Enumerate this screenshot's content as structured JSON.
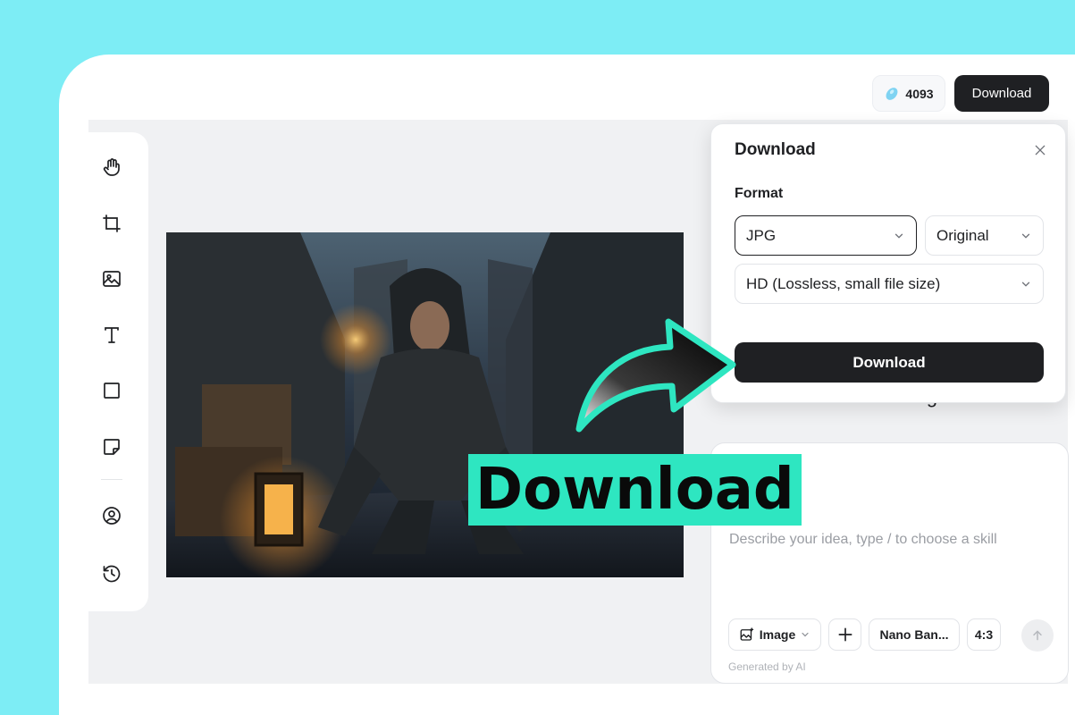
{
  "header": {
    "credits": "4093",
    "download_label": "Download"
  },
  "toolbar": {
    "tools": [
      {
        "icon": "hand-icon"
      },
      {
        "icon": "crop-icon"
      },
      {
        "icon": "image-icon"
      },
      {
        "icon": "text-icon"
      },
      {
        "icon": "rectangle-icon"
      },
      {
        "icon": "sticky-note-icon"
      },
      {
        "icon": "user-circle-icon"
      },
      {
        "icon": "history-icon"
      }
    ]
  },
  "dialog": {
    "title": "Download",
    "format_label": "Format",
    "format_value": "JPG",
    "size_value": "Original",
    "quality_value": "HD (Lossless, small file size)",
    "download_label": "Download"
  },
  "chat": {
    "heading_partial": "Generate \"metal 3D logo\"",
    "placeholder": "Describe your idea, type / to choose a skill",
    "mode_label": "Image",
    "model_label": "Nano Ban...",
    "ratio_label": "4:3",
    "generated_note": "Generated by AI"
  },
  "overlay": {
    "banner_text": "Download"
  },
  "colors": {
    "background": "#7DEDF5",
    "accent": "#2EE6C1",
    "dark_button": "#1F2023"
  }
}
